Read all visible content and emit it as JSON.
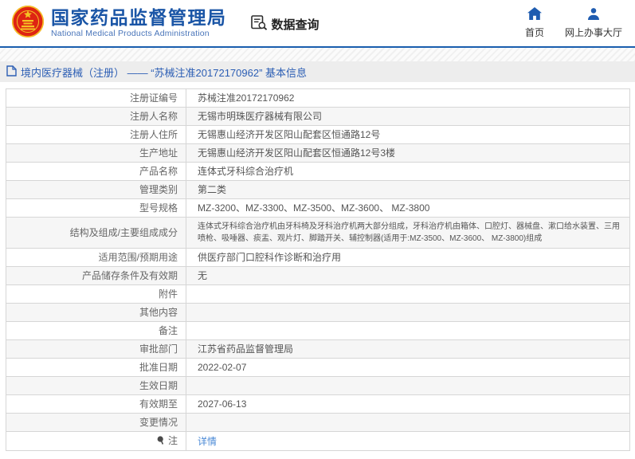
{
  "header": {
    "org_name": "国家药品监督管理局",
    "org_name_en": "National Medical Products Administration",
    "section_title": "数据查询",
    "nav_home": "首页",
    "nav_service_hall": "网上办事大厅"
  },
  "breadcrumb": {
    "text": "境内医疗器械（注册） —— “苏械注准20172170962” 基本信息"
  },
  "table": {
    "rows": [
      {
        "label": "注册证编号",
        "value": "苏械注准20172170962"
      },
      {
        "label": "注册人名称",
        "value": "无锡市明珠医疗器械有限公司"
      },
      {
        "label": "注册人住所",
        "value": "无锡惠山经济开发区阳山配套区恒通路12号"
      },
      {
        "label": "生产地址",
        "value": "无锡惠山经济开发区阳山配套区恒通路12号3楼"
      },
      {
        "label": "产品名称",
        "value": "连体式牙科综合治疗机"
      },
      {
        "label": "管理类别",
        "value": "第二类"
      },
      {
        "label": "型号规格",
        "value": "MZ-3200、MZ-3300、MZ-3500、MZ-3600、 MZ-3800"
      },
      {
        "label": "结构及组成/主要组成成分",
        "value": "连体式牙科综合治疗机由牙科椅及牙科治疗机两大部分组成，牙科治疗机由箱体、口腔灯、器械盘、漱口给水装置、三用喷枪、吸唾器、痰盂、观片灯、脚踏开关、辅控制器(适用于:MZ-3500、MZ-3600、 MZ-3800)组成"
      },
      {
        "label": "适用范围/预期用途",
        "value": "供医疗部门口腔科作诊断和治疗用"
      },
      {
        "label": "产品储存条件及有效期",
        "value": "无"
      },
      {
        "label": "附件",
        "value": ""
      },
      {
        "label": "其他内容",
        "value": ""
      },
      {
        "label": "备注",
        "value": ""
      },
      {
        "label": "审批部门",
        "value": "江苏省药品监督管理局"
      },
      {
        "label": "批准日期",
        "value": "2022-02-07"
      },
      {
        "label": "生效日期",
        "value": ""
      },
      {
        "label": "有效期至",
        "value": "2027-06-13"
      },
      {
        "label": "变更情况",
        "value": ""
      },
      {
        "label": "注",
        "value": "详情"
      }
    ]
  },
  "colors": {
    "brand_blue": "#1a55a6",
    "accent_line_blue": "#1a5eae",
    "breadcrumb_blue": "#2c5eb4",
    "link_blue": "#4a89d6",
    "breadcrumb_bg": "#ededed",
    "row_alt_bg": "#f6f6f6",
    "border_gray": "#d6d6d6",
    "emblem_red": "#de2413",
    "emblem_gold": "#f5c324"
  },
  "icons": {
    "emblem": "national-emblem-icon",
    "data_query": "data-search-icon",
    "home": "home-icon",
    "service_hall": "user-icon",
    "breadcrumb": "document-icon",
    "note": "note-pin-icon"
  }
}
